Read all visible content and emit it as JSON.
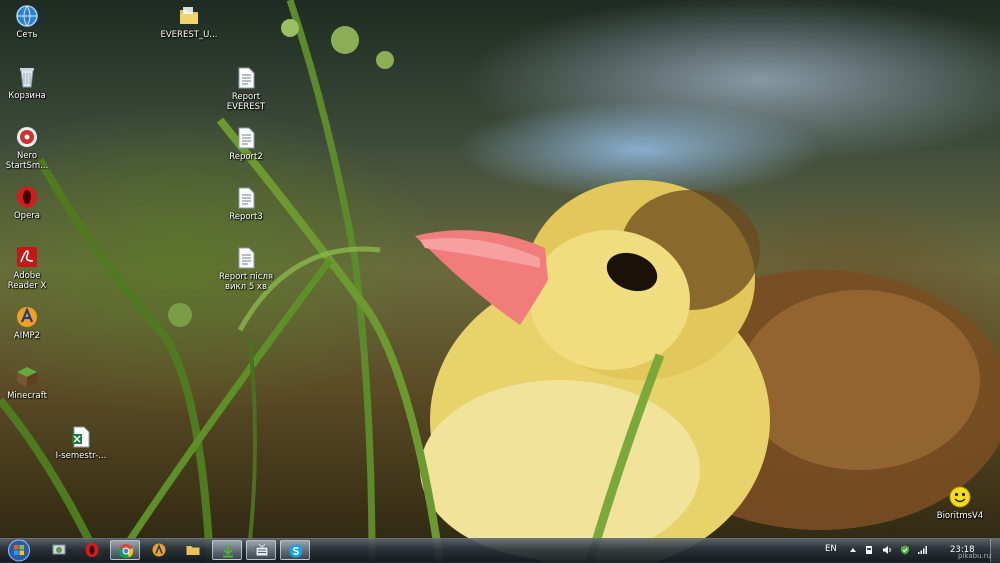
{
  "desktop": {
    "icons": [
      {
        "label": "Сеть",
        "icon": "network-icon"
      },
      {
        "label": "Корзина",
        "icon": "recycle-bin-icon"
      },
      {
        "label": "Nero\nStartSm...",
        "icon": "nero-icon"
      },
      {
        "label": "Opera",
        "icon": "opera-icon"
      },
      {
        "label": "Adobe\nReader X",
        "icon": "adobe-reader-icon"
      },
      {
        "label": "AIMP2",
        "icon": "aimp-icon"
      },
      {
        "label": "Minecraft",
        "icon": "minecraft-icon"
      },
      {
        "label": "I-semestr-...",
        "icon": "excel-file-icon"
      },
      {
        "label": "EVEREST_U...",
        "icon": "folder-icon"
      },
      {
        "label": "Report\nEVEREST",
        "icon": "text-file-icon"
      },
      {
        "label": "Report2",
        "icon": "text-file-icon"
      },
      {
        "label": "Report3",
        "icon": "text-file-icon"
      },
      {
        "label": "Report після\nвикл 5 хв",
        "icon": "text-file-icon"
      },
      {
        "label": "BioritmsV4",
        "icon": "smiley-icon"
      }
    ]
  },
  "taskbar": {
    "pinned": [
      {
        "icon": "explorer-app-icon",
        "active": false
      },
      {
        "icon": "opera-icon",
        "active": false
      },
      {
        "icon": "chrome-icon",
        "active": true
      },
      {
        "icon": "aimp-icon",
        "active": false
      },
      {
        "icon": "folder-icon",
        "active": false
      },
      {
        "icon": "download-icon",
        "active": true
      },
      {
        "icon": "tv-icon",
        "active": true
      },
      {
        "icon": "skype-icon",
        "active": true
      }
    ],
    "tray": {
      "language": "EN",
      "time": "23:18"
    }
  },
  "watermark": "pikabu.ru",
  "colors": {
    "taskbar": "#1a2026",
    "label_text": "#ffffff"
  }
}
